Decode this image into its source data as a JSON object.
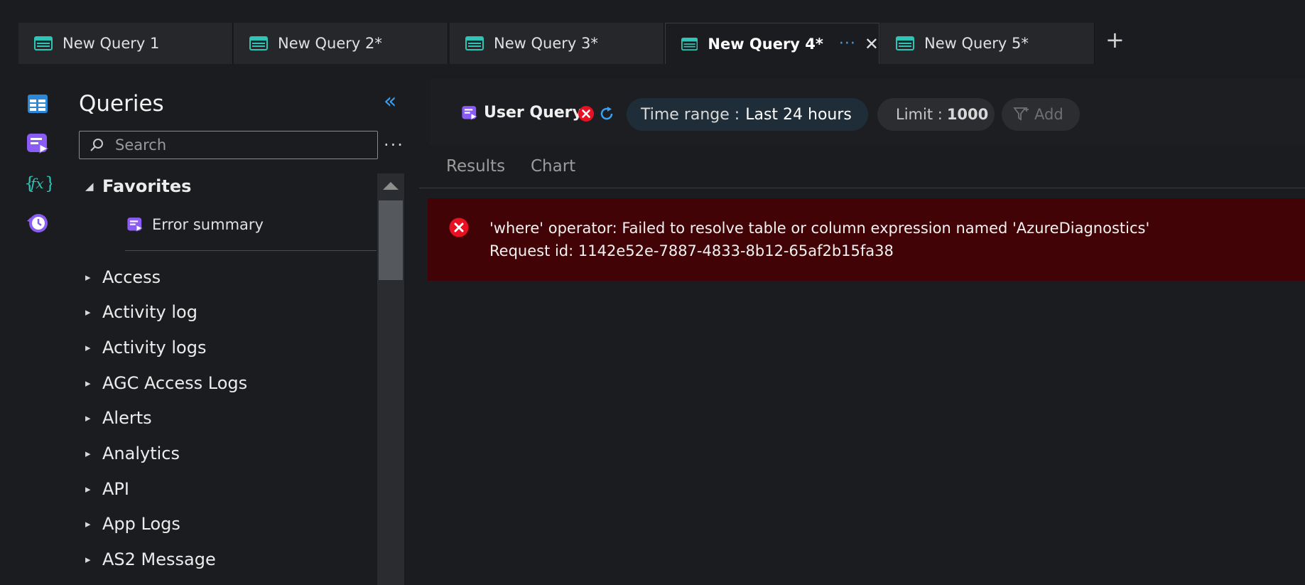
{
  "tabs": [
    {
      "label": "New Query 1",
      "active": false
    },
    {
      "label": "New Query 2*",
      "active": false
    },
    {
      "label": "New Query 3*",
      "active": false
    },
    {
      "label": "New Query 4*",
      "active": true
    },
    {
      "label": "New Query 5*",
      "active": false
    }
  ],
  "tab_actions": {
    "more": "···",
    "close": "✕",
    "new_tab": "+"
  },
  "rail": [
    {
      "icon": "tables-icon"
    },
    {
      "icon": "queries-icon"
    },
    {
      "icon": "functions-icon"
    },
    {
      "icon": "query-history-icon"
    }
  ],
  "sidebar": {
    "title": "Queries",
    "collapse": "«",
    "search_placeholder": "Search",
    "more": "···",
    "favorites": {
      "label": "Favorites",
      "children": [
        {
          "label": "Error summary"
        }
      ]
    },
    "categories": [
      {
        "label": "Access"
      },
      {
        "label": "Activity log"
      },
      {
        "label": "Activity logs"
      },
      {
        "label": "AGC Access Logs"
      },
      {
        "label": "Alerts"
      },
      {
        "label": "Analytics"
      },
      {
        "label": "API"
      },
      {
        "label": "App Logs"
      },
      {
        "label": "AS2 Message"
      }
    ]
  },
  "toolbar": {
    "query_label": "User Query",
    "time_range_label": "Time range :",
    "time_range_value": "Last 24 hours",
    "limit_label": "Limit :",
    "limit_value": "1000",
    "add_filter_label": "Add"
  },
  "result_tabs": [
    {
      "label": "Results"
    },
    {
      "label": "Chart"
    }
  ],
  "error": {
    "message": "'where' operator: Failed to resolve table or column expression named 'AzureDiagnostics'",
    "request_id": "Request id: 1142e52e-7887-4833-8b12-65af2b15fa38"
  },
  "colors": {
    "accent": "#3aa0f3",
    "error_bg": "#420307",
    "error_icon": "#e81123",
    "query_icon": "#8a5cf5"
  }
}
